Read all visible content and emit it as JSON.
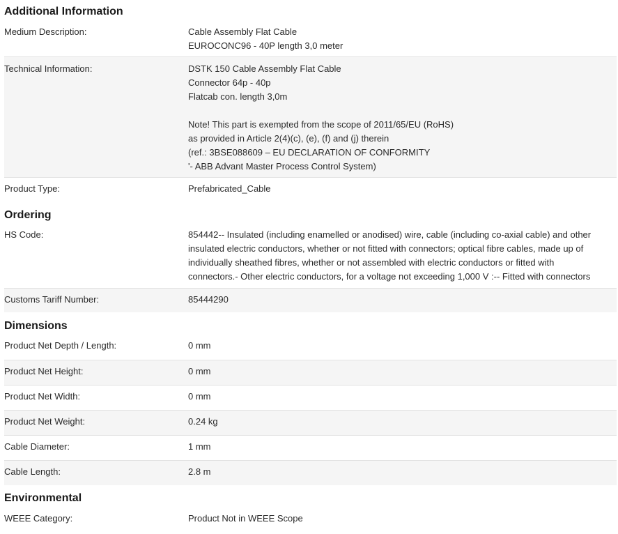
{
  "sections": {
    "additional": {
      "title": "Additional Information",
      "rows": [
        {
          "label": "Medium Description:",
          "lines": [
            "Cable Assembly Flat Cable",
            "EUROCONC96 - 40P length 3,0 meter"
          ]
        },
        {
          "label": "Technical Information:",
          "lines": [
            "DSTK 150 Cable Assembly Flat Cable",
            "Connector 64p - 40p",
            "Flatcab con. length 3,0m",
            "",
            "Note! This part is exempted from the scope of 2011/65/EU (RoHS)",
            "as provided in Article 2(4)(c), (e), (f) and (j) therein",
            "(ref.: 3BSE088609 – EU DECLARATION OF CONFORMITY",
            "'- ABB Advant Master Process Control System)"
          ]
        },
        {
          "label": "Product Type:",
          "lines": [
            "Prefabricated_Cable"
          ]
        }
      ]
    },
    "ordering": {
      "title": "Ordering",
      "rows": [
        {
          "label": "HS Code:",
          "lines": [
            "854442-- Insulated (including enamelled or anodised) wire, cable (including co-axial cable) and other",
            "insulated electric conductors, whether or not fitted with connectors; optical fibre cables, made up of",
            "individually sheathed fibres, whether or not assembled with electric conductors or fitted with",
            "connectors.- Other electric conductors, for a voltage not exceeding 1,000 V :-- Fitted with connectors"
          ]
        },
        {
          "label": "Customs Tariff Number:",
          "lines": [
            "85444290"
          ]
        }
      ]
    },
    "dimensions": {
      "title": "Dimensions",
      "rows": [
        {
          "label": "Product Net Depth / Length:",
          "lines": [
            "0 mm"
          ]
        },
        {
          "label": "Product Net Height:",
          "lines": [
            "0 mm"
          ]
        },
        {
          "label": "Product Net Width:",
          "lines": [
            "0 mm"
          ]
        },
        {
          "label": "Product Net Weight:",
          "lines": [
            "0.24 kg"
          ]
        },
        {
          "label": "Cable Diameter:",
          "lines": [
            "1 mm"
          ]
        },
        {
          "label": "Cable Length:",
          "lines": [
            "2.8 m"
          ]
        }
      ]
    },
    "environmental": {
      "title": "Environmental",
      "rows": [
        {
          "label": "WEEE Category:",
          "lines": [
            "Product Not in WEEE Scope"
          ]
        }
      ]
    }
  }
}
